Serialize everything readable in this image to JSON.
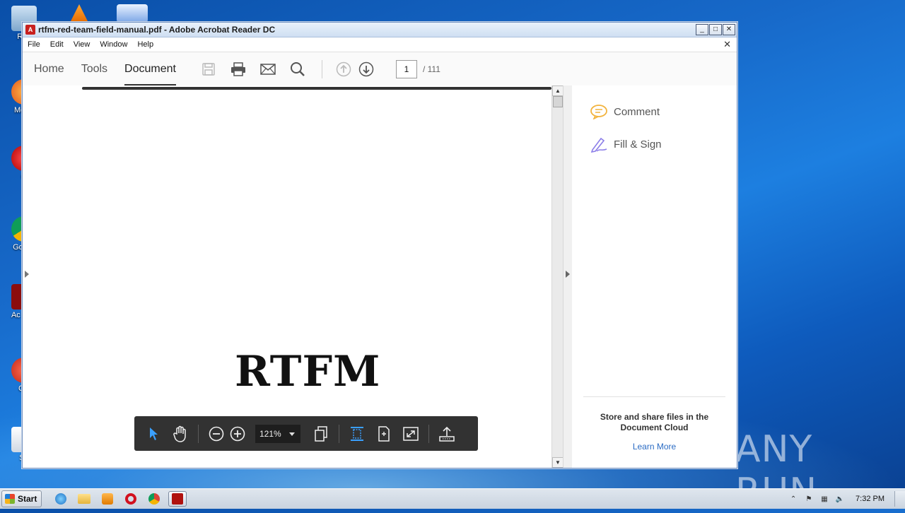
{
  "window": {
    "title": "rtfm-red-team-field-manual.pdf - Adobe Acrobat Reader DC",
    "controls": {
      "minimize": "_",
      "maximize": "□",
      "close": "✕"
    }
  },
  "menu": {
    "items": [
      "File",
      "Edit",
      "View",
      "Window",
      "Help"
    ],
    "close_doc": "✕"
  },
  "toolbar": {
    "tabs": [
      "Home",
      "Tools",
      "Document"
    ],
    "active_tab": "Document",
    "page_current": "1",
    "page_total": "/ 111"
  },
  "document": {
    "title_text": "RTFM"
  },
  "right_pane": {
    "comment_label": "Comment",
    "fill_sign_label": "Fill & Sign",
    "cloud_text": "Store and share files in the Document Cloud",
    "learn_more": "Learn More"
  },
  "floating_toolbar": {
    "zoom": "121%"
  },
  "desktop": {
    "icons": [
      "Rec",
      "Mozill",
      "O",
      "Go Ch",
      "Ac Rea",
      "CC",
      "Sh"
    ],
    "watermark": "ANY RUN"
  },
  "taskbar": {
    "start_label": "Start",
    "clock": "7:32 PM"
  },
  "colors": {
    "accent_blue": "#2b6cc4",
    "pdf_red": "#c8201e",
    "float_bar": "#323232"
  }
}
